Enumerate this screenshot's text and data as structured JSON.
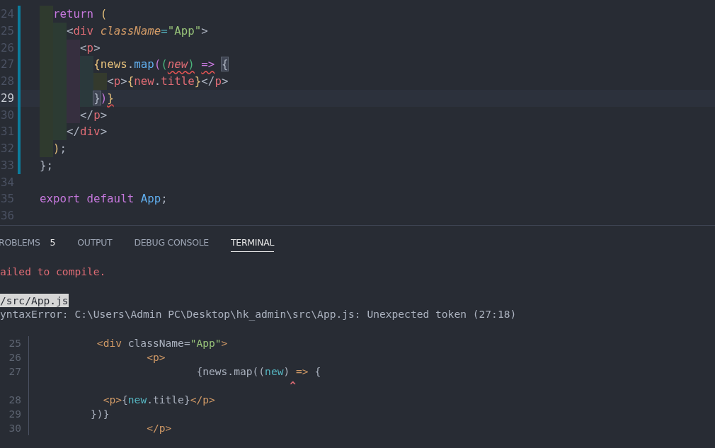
{
  "editor": {
    "lines": [
      {
        "number": "24",
        "modified": true,
        "current": false,
        "tokens": [
          {
            "kind": "keyword",
            "text": "  return"
          },
          {
            "kind": "paren",
            "text": " ("
          }
        ]
      },
      {
        "number": "25",
        "modified": true,
        "current": false,
        "tokens": [
          {
            "kind": "punct",
            "text": "    <"
          },
          {
            "kind": "tag",
            "text": "div"
          },
          {
            "kind": "attr",
            "text": " className"
          },
          {
            "kind": "operator",
            "text": "="
          },
          {
            "kind": "string",
            "text": "\"App\""
          },
          {
            "kind": "punct",
            "text": ">"
          }
        ]
      },
      {
        "number": "26",
        "modified": true,
        "current": false,
        "tokens": [
          {
            "kind": "punct",
            "text": "      <"
          },
          {
            "kind": "tag",
            "text": "p"
          },
          {
            "kind": "punct",
            "text": ">"
          }
        ]
      },
      {
        "number": "27",
        "modified": true,
        "current": false,
        "tokens": [
          {
            "kind": "paren",
            "text": "        {"
          },
          {
            "kind": "variable",
            "text": "news"
          },
          {
            "kind": "punct",
            "text": "."
          },
          {
            "kind": "function",
            "text": "map"
          },
          {
            "kind": "bracket2",
            "text": "("
          },
          {
            "kind": "bracket3",
            "text": "("
          },
          {
            "kind": "param",
            "text": "new",
            "error": true
          },
          {
            "kind": "bracket3",
            "text": ")",
            "error": true
          },
          {
            "kind": "keyword",
            "text": " =>",
            "error": true
          },
          {
            "kind": "matched",
            "text": " {"
          }
        ]
      },
      {
        "number": "28",
        "modified": true,
        "current": false,
        "tokens": [
          {
            "kind": "punct",
            "text": "          <"
          },
          {
            "kind": "tag",
            "text": "p"
          },
          {
            "kind": "punct",
            "text": ">"
          },
          {
            "kind": "paren",
            "text": "{"
          },
          {
            "kind": "tag",
            "text": "new"
          },
          {
            "kind": "punct",
            "text": "."
          },
          {
            "kind": "tag",
            "text": "title"
          },
          {
            "kind": "paren",
            "text": "}"
          },
          {
            "kind": "punct",
            "text": "</"
          },
          {
            "kind": "tag",
            "text": "p"
          },
          {
            "kind": "punct",
            "text": ">"
          }
        ]
      },
      {
        "number": "29",
        "modified": true,
        "current": true,
        "tokens": [
          {
            "kind": "matched",
            "text": "        }"
          },
          {
            "kind": "bracket2",
            "text": ")"
          },
          {
            "kind": "paren",
            "text": "}",
            "error": true
          }
        ]
      },
      {
        "number": "30",
        "modified": true,
        "current": false,
        "tokens": [
          {
            "kind": "punct",
            "text": "      </"
          },
          {
            "kind": "tag",
            "text": "p"
          },
          {
            "kind": "punct",
            "text": ">"
          }
        ]
      },
      {
        "number": "31",
        "modified": true,
        "current": false,
        "tokens": [
          {
            "kind": "punct",
            "text": "    </"
          },
          {
            "kind": "tag",
            "text": "div"
          },
          {
            "kind": "punct",
            "text": ">"
          }
        ]
      },
      {
        "number": "32",
        "modified": true,
        "current": false,
        "tokens": [
          {
            "kind": "paren",
            "text": "  )"
          },
          {
            "kind": "punct",
            "text": ";"
          }
        ]
      },
      {
        "number": "33",
        "modified": true,
        "current": false,
        "tokens": [
          {
            "kind": "plain",
            "text": "};"
          }
        ]
      },
      {
        "number": "34",
        "modified": false,
        "current": false
      },
      {
        "number": "35",
        "modified": false,
        "current": false,
        "tokens": [
          {
            "kind": "keyword",
            "text": "export default"
          },
          {
            "kind": "function",
            "text": " App"
          },
          {
            "kind": "plain",
            "text": ";"
          }
        ]
      },
      {
        "number": "36",
        "modified": false,
        "current": false
      }
    ]
  },
  "panel": {
    "tabs": [
      {
        "label": "ROBLEMS",
        "badge": "5",
        "selected": false
      },
      {
        "label": "OUTPUT",
        "selected": false
      },
      {
        "label": "DEBUG CONSOLE",
        "selected": false
      },
      {
        "label": "TERMINAL",
        "selected": true
      }
    ],
    "terminal": [
      {
        "kind": "error",
        "text": "ailed to compile."
      },
      {
        "kind": "file",
        "text": "/src/App.js"
      },
      {
        "kind": "message",
        "text": "yntaxError: C:\\Users\\Admin PC\\Desktop\\hk_admin\\src\\App.js: Unexpected token (27:18)"
      },
      {
        "kind": "frame",
        "number": "25",
        "tokens": [
          {
            "kind": "tag",
            "text": "          <div"
          },
          {
            "kind": "plain",
            "text": " className="
          },
          {
            "kind": "string",
            "text": "\"App\""
          },
          {
            "kind": "tag",
            "text": ">"
          }
        ]
      },
      {
        "kind": "frame",
        "number": "26",
        "tokens": [
          {
            "kind": "tag",
            "text": "                  <p>"
          }
        ]
      },
      {
        "kind": "frame",
        "number": "27",
        "tokens": [
          {
            "kind": "plain",
            "text": "                          {news.map(("
          },
          {
            "kind": "name",
            "text": "new"
          },
          {
            "kind": "plain",
            "text": ")"
          },
          {
            "kind": "tag",
            "text": " =>"
          },
          {
            "kind": "plain",
            "text": " {"
          }
        ]
      },
      {
        "kind": "caret",
        "text": "                                         ^"
      },
      {
        "kind": "frame",
        "number": "28",
        "tokens": [
          {
            "kind": "tag",
            "text": "           <p>"
          },
          {
            "kind": "plain",
            "text": "{"
          },
          {
            "kind": "name",
            "text": "new"
          },
          {
            "kind": "plain",
            "text": ".title}"
          },
          {
            "kind": "tag",
            "text": "</p>"
          }
        ]
      },
      {
        "kind": "frame",
        "number": "29",
        "tokens": [
          {
            "kind": "plain",
            "text": "         })}"
          }
        ]
      },
      {
        "kind": "frame",
        "number": "30",
        "tokens": [
          {
            "kind": "tag",
            "text": "                  </p>"
          }
        ]
      }
    ]
  }
}
